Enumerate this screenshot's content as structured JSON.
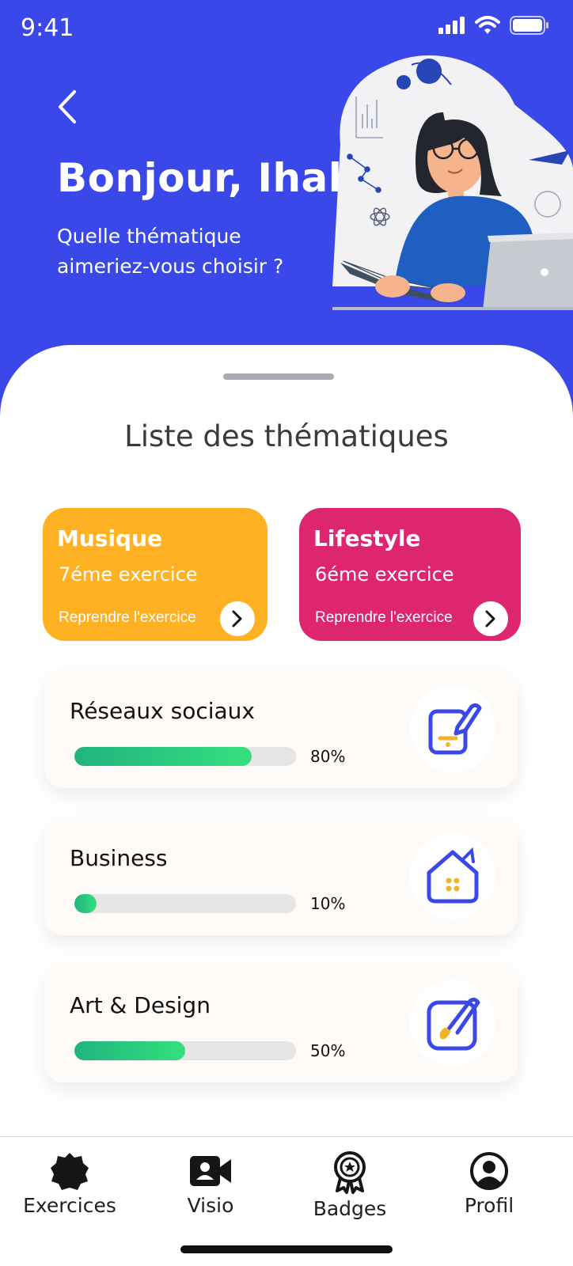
{
  "status_bar": {
    "time": "9:41"
  },
  "header": {
    "greeting": "Bonjour, Ihab",
    "subtitle": "Quelle thématique aimeriez-vous choisir ?",
    "illustration_icon": "woman-reading-illustration"
  },
  "section": {
    "title": "Liste des thématiques"
  },
  "featured": [
    {
      "name": "Musique",
      "exercise": "7éme exercice",
      "resume_label": "Reprendre l'exercice",
      "color": "#fdb123"
    },
    {
      "name": "Lifestyle",
      "exercise": "6éme exercice",
      "resume_label": "Reprendre l'exercice",
      "color": "#dd2570"
    }
  ],
  "themes": [
    {
      "name": "Réseaux sociaux",
      "progress": 80,
      "progress_label": "80%",
      "icon": "phone-edit-icon"
    },
    {
      "name": "Business",
      "progress": 10,
      "progress_label": "10%",
      "icon": "house-icon"
    },
    {
      "name": "Art & Design",
      "progress": 50,
      "progress_label": "50%",
      "icon": "brush-edit-icon"
    }
  ],
  "tabbar": {
    "items": [
      {
        "label": "Exercices",
        "icon": "badge-star-icon"
      },
      {
        "label": "Visio",
        "icon": "video-user-icon"
      },
      {
        "label": "Badges",
        "icon": "medal-icon"
      },
      {
        "label": "Profil",
        "icon": "user-circle-icon"
      }
    ]
  },
  "colors": {
    "primary": "#3a48ea",
    "progress_start": "#20b47e",
    "progress_end": "#34e07e",
    "icon_blue": "#3a48ea",
    "icon_accent": "#f3b22b"
  }
}
